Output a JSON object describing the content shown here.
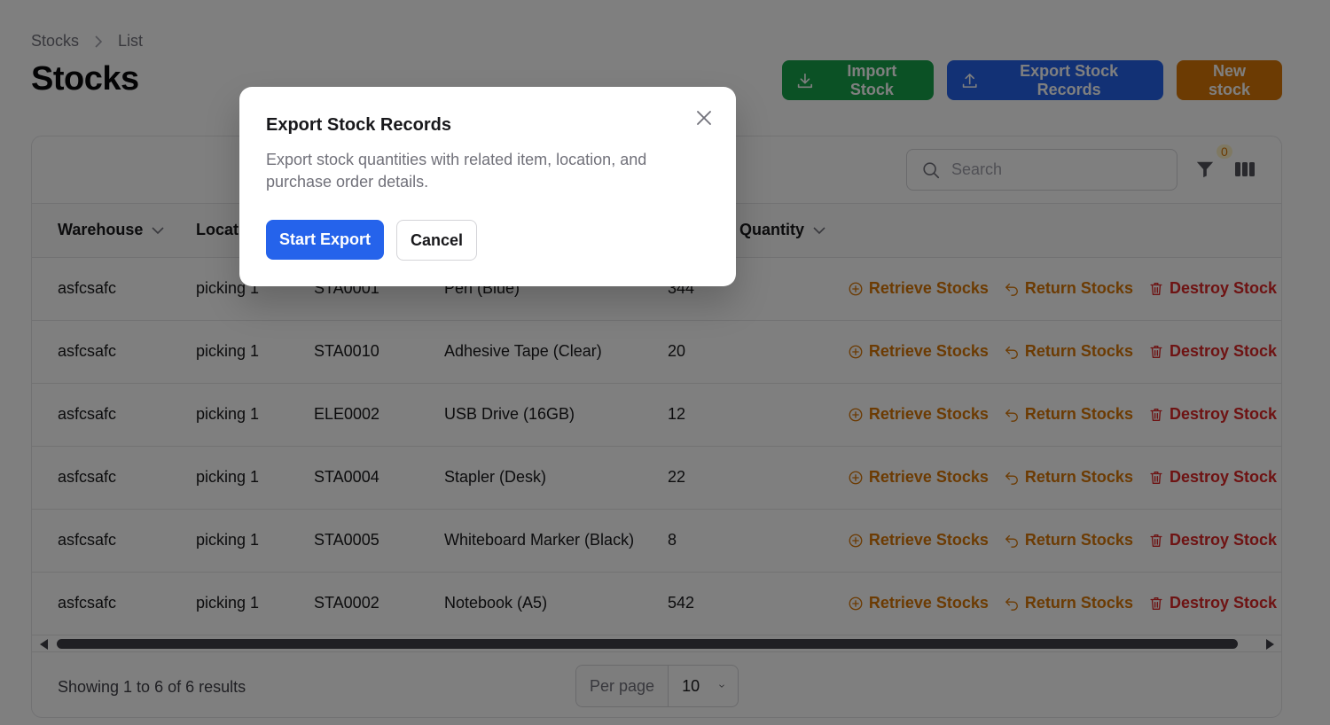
{
  "breadcrumb": {
    "root": "Stocks",
    "current": "List"
  },
  "page_title": "Stocks",
  "header_actions": {
    "import": "Import Stock",
    "export": "Export Stock Records",
    "new": "New stock"
  },
  "toolbar": {
    "search_placeholder": "Search",
    "filter_count": "0"
  },
  "columns": [
    "Warehouse",
    "Location",
    "Quantity"
  ],
  "rows": [
    {
      "warehouse": "asfcsafc",
      "location": "picking 1",
      "code": "STA0001",
      "item": "Pen (Blue)",
      "qty": "344"
    },
    {
      "warehouse": "asfcsafc",
      "location": "picking 1",
      "code": "STA0010",
      "item": "Adhesive Tape (Clear)",
      "qty": "20"
    },
    {
      "warehouse": "asfcsafc",
      "location": "picking 1",
      "code": "ELE0002",
      "item": "USB Drive (16GB)",
      "qty": "12"
    },
    {
      "warehouse": "asfcsafc",
      "location": "picking 1",
      "code": "STA0004",
      "item": "Stapler (Desk)",
      "qty": "22"
    },
    {
      "warehouse": "asfcsafc",
      "location": "picking 1",
      "code": "STA0005",
      "item": "Whiteboard Marker (Black)",
      "qty": "8"
    },
    {
      "warehouse": "asfcsafc",
      "location": "picking 1",
      "code": "STA0002",
      "item": "Notebook (A5)",
      "qty": "542"
    }
  ],
  "row_actions": {
    "retrieve": "Retrieve Stocks",
    "return": "Return Stocks",
    "destroy": "Destroy Stock"
  },
  "footer": {
    "showing": "Showing 1 to 6 of 6 results",
    "per_page_label": "Per page",
    "per_page_value": "10"
  },
  "modal": {
    "title": "Export Stock Records",
    "description": "Export stock quantities with related item, location, and purchase order details.",
    "start": "Start Export",
    "cancel": "Cancel"
  },
  "colors": {
    "green": "#16a34a",
    "blue": "#2563eb",
    "orange": "#d97706",
    "danger": "#dc2626"
  }
}
